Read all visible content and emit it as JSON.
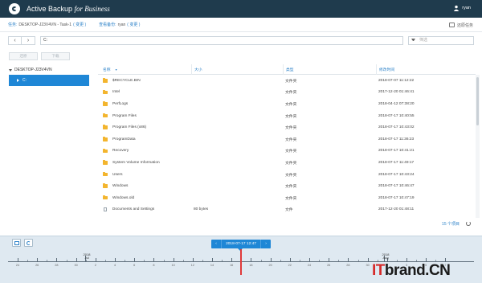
{
  "app": {
    "title": "Active Backup",
    "title_italic": "for Business",
    "user": "ryan"
  },
  "info": {
    "task_label": "任务:",
    "task_value": "DESKTOP-J23V4VN - Task-1",
    "task_link": "( 变更 )",
    "restorer_label": "查看备份:",
    "restorer_value": "ryan",
    "restorer_link": "( 变更 )",
    "restore_task_button": "还原任务"
  },
  "nav": {
    "back": "‹",
    "forward": "›",
    "path": "C:",
    "filter_placeholder": "筛选"
  },
  "actions": {
    "restore": "还原",
    "download": "下载"
  },
  "tree": {
    "root": "DESKTOP-J23V4VN",
    "selected": "C:"
  },
  "table": {
    "headers": [
      "名称",
      "大小",
      "类型",
      "修改时间"
    ],
    "rows": [
      {
        "icon": "folder",
        "name": "$RECYCLE.BIN",
        "size": "",
        "type": "文件夹",
        "modified": "2018-07-07 11:12:22"
      },
      {
        "icon": "folder",
        "name": "Intel",
        "size": "",
        "type": "文件夹",
        "modified": "2017-12-20 01:46:41"
      },
      {
        "icon": "folder",
        "name": "PerfLogs",
        "size": "",
        "type": "文件夹",
        "modified": "2018-04-12 07:38:20"
      },
      {
        "icon": "folder",
        "name": "Program Files",
        "size": "",
        "type": "文件夹",
        "modified": "2018-07-17 10:40:55"
      },
      {
        "icon": "folder",
        "name": "Program Files (x86)",
        "size": "",
        "type": "文件夹",
        "modified": "2018-07-17 10:43:02"
      },
      {
        "icon": "folder",
        "name": "ProgramData",
        "size": "",
        "type": "文件夹",
        "modified": "2018-07-17 11:36:23"
      },
      {
        "icon": "folder",
        "name": "Recovery",
        "size": "",
        "type": "文件夹",
        "modified": "2018-07-17 10:41:21"
      },
      {
        "icon": "folder",
        "name": "System Volume Information",
        "size": "",
        "type": "文件夹",
        "modified": "2018-07-17 11:49:17"
      },
      {
        "icon": "folder",
        "name": "Users",
        "size": "",
        "type": "文件夹",
        "modified": "2018-07-17 10:43:24"
      },
      {
        "icon": "folder",
        "name": "Windows",
        "size": "",
        "type": "文件夹",
        "modified": "2018-07-17 10:46:47"
      },
      {
        "icon": "folder",
        "name": "Windows.old",
        "size": "",
        "type": "文件夹",
        "modified": "2018-07-17 10:47:19"
      },
      {
        "icon": "file",
        "name": "Documents and Settings",
        "size": "80 bytes",
        "type": "文件",
        "modified": "2017-12-20 01:48:11"
      }
    ],
    "count_text": "15 个项目"
  },
  "timeline": {
    "prev": "‹",
    "next": "›",
    "current": "2018-07-17 12:47",
    "year_markers": [
      {
        "year": "2018",
        "month": "Jul"
      },
      {
        "year": "2018",
        "month": "Aug"
      }
    ],
    "day_labels": [
      "24",
      "26",
      "28",
      "30",
      "2",
      "4",
      "6",
      "8",
      "10",
      "12",
      "14",
      "16",
      "18",
      "20",
      "22",
      "24",
      "26",
      "28",
      "30",
      "1",
      "3",
      "5",
      "7"
    ]
  },
  "watermark": {
    "prefix": "IT",
    "brand": "brand.CN"
  }
}
